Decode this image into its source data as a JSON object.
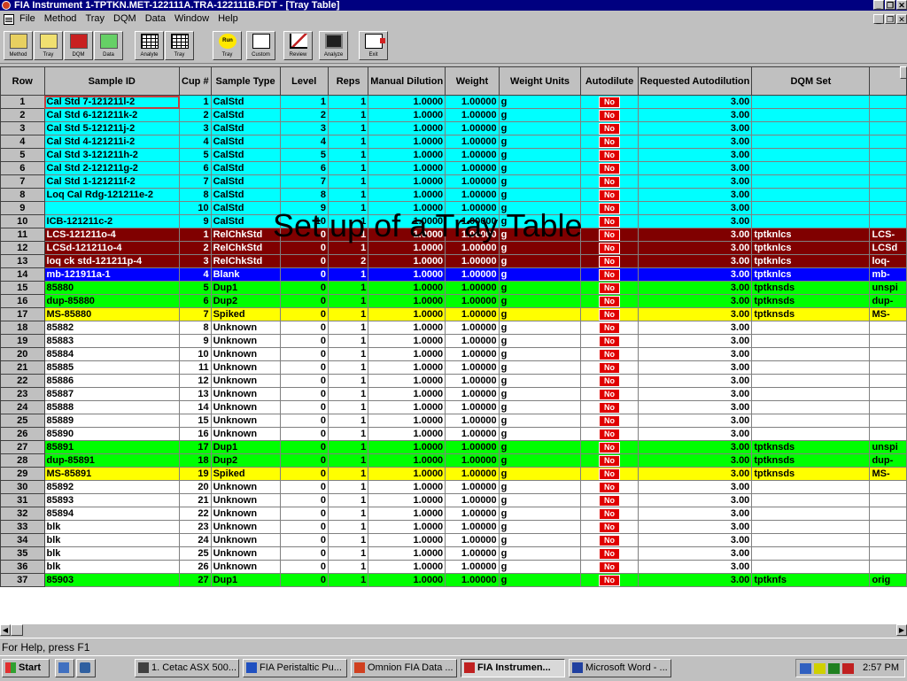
{
  "window": {
    "title": "FIA Instrument 1-TPTKN.MET-122111A.TRA-122111B.FDT - [Tray Table]"
  },
  "menu": [
    "File",
    "Method",
    "Tray",
    "DQM",
    "Data",
    "Window",
    "Help"
  ],
  "toolbar": [
    {
      "label": "Method",
      "icon": "folder-open-icon"
    },
    {
      "label": "Tray",
      "icon": "folder-open-icon"
    },
    {
      "label": "DQM",
      "icon": "folder-red-icon"
    },
    {
      "label": "Data",
      "icon": "folder-green-icon"
    },
    {
      "label": "Analyte",
      "icon": "grid-icon"
    },
    {
      "label": "Tray",
      "icon": "grid-icon"
    },
    {
      "label": "Tray",
      "icon": "run-icon"
    },
    {
      "label": "Custom",
      "icon": "chart-icon"
    },
    {
      "label": "Review",
      "icon": "review-icon"
    },
    {
      "label": "Analyze",
      "icon": "analyze-icon"
    },
    {
      "label": "Exit",
      "icon": "exit-icon"
    }
  ],
  "run_icon_text": "Run",
  "columns": [
    "Row",
    "Sample ID",
    "Cup #",
    "Sample Type",
    "Level",
    "Reps",
    "Manual Dilution",
    "Weight",
    "Weight Units",
    "Autodilute",
    "Requested Autodilution",
    "DQM Set",
    ""
  ],
  "colors": {
    "cyan": "#00ffff",
    "maroon": "#800000",
    "blue": "#0000ff",
    "green": "#00ff00",
    "yellow": "#ffff00",
    "white": "#ffffff"
  },
  "rows": [
    {
      "row": "1",
      "id": "Cal Std 7-121211l-2",
      "cup": "1",
      "type": "CalStd",
      "level": "1",
      "reps": "1",
      "dil": "1.0000",
      "weight": "1.00000",
      "units": "g",
      "auto": "No",
      "req": "3.00",
      "dqm": "",
      "extra": "",
      "color": "cyan"
    },
    {
      "row": "2",
      "id": "Cal Std 6-121211k-2",
      "cup": "2",
      "type": "CalStd",
      "level": "2",
      "reps": "1",
      "dil": "1.0000",
      "weight": "1.00000",
      "units": "g",
      "auto": "No",
      "req": "3.00",
      "dqm": "",
      "extra": "",
      "color": "cyan"
    },
    {
      "row": "3",
      "id": "Cal Std 5-121211j-2",
      "cup": "3",
      "type": "CalStd",
      "level": "3",
      "reps": "1",
      "dil": "1.0000",
      "weight": "1.00000",
      "units": "g",
      "auto": "No",
      "req": "3.00",
      "dqm": "",
      "extra": "",
      "color": "cyan"
    },
    {
      "row": "4",
      "id": "Cal Std 4-121211i-2",
      "cup": "4",
      "type": "CalStd",
      "level": "4",
      "reps": "1",
      "dil": "1.0000",
      "weight": "1.00000",
      "units": "g",
      "auto": "No",
      "req": "3.00",
      "dqm": "",
      "extra": "",
      "color": "cyan"
    },
    {
      "row": "5",
      "id": "Cal Std 3-121211h-2",
      "cup": "5",
      "type": "CalStd",
      "level": "5",
      "reps": "1",
      "dil": "1.0000",
      "weight": "1.00000",
      "units": "g",
      "auto": "No",
      "req": "3.00",
      "dqm": "",
      "extra": "",
      "color": "cyan"
    },
    {
      "row": "6",
      "id": "Cal Std 2-121211g-2",
      "cup": "6",
      "type": "CalStd",
      "level": "6",
      "reps": "1",
      "dil": "1.0000",
      "weight": "1.00000",
      "units": "g",
      "auto": "No",
      "req": "3.00",
      "dqm": "",
      "extra": "",
      "color": "cyan"
    },
    {
      "row": "7",
      "id": "Cal Std 1-121211f-2",
      "cup": "7",
      "type": "CalStd",
      "level": "7",
      "reps": "1",
      "dil": "1.0000",
      "weight": "1.00000",
      "units": "g",
      "auto": "No",
      "req": "3.00",
      "dqm": "",
      "extra": "",
      "color": "cyan"
    },
    {
      "row": "8",
      "id": "Loq Cal Rdg-121211e-2",
      "cup": "8",
      "type": "CalStd",
      "level": "8",
      "reps": "1",
      "dil": "1.0000",
      "weight": "1.00000",
      "units": "g",
      "auto": "No",
      "req": "3.00",
      "dqm": "",
      "extra": "",
      "color": "cyan"
    },
    {
      "row": "9",
      "id": "",
      "cup": "10",
      "type": "CalStd",
      "level": "9",
      "reps": "1",
      "dil": "1.0000",
      "weight": "1.00000",
      "units": "g",
      "auto": "No",
      "req": "3.00",
      "dqm": "",
      "extra": "",
      "color": "cyan"
    },
    {
      "row": "10",
      "id": "ICB-121211c-2",
      "cup": "9",
      "type": "CalStd",
      "level": "10",
      "reps": "1",
      "dil": "1.0000",
      "weight": "1.00000",
      "units": "g",
      "auto": "No",
      "req": "3.00",
      "dqm": "",
      "extra": "",
      "color": "cyan"
    },
    {
      "row": "11",
      "id": "LCS-121211o-4",
      "cup": "1",
      "type": "RelChkStd",
      "level": "0",
      "reps": "1",
      "dil": "1.0000",
      "weight": "1.00000",
      "units": "g",
      "auto": "No",
      "req": "3.00",
      "dqm": "tptknlcs",
      "extra": "LCS-",
      "color": "maroon"
    },
    {
      "row": "12",
      "id": "LCSd-121211o-4",
      "cup": "2",
      "type": "RelChkStd",
      "level": "0",
      "reps": "1",
      "dil": "1.0000",
      "weight": "1.00000",
      "units": "g",
      "auto": "No",
      "req": "3.00",
      "dqm": "tptknlcs",
      "extra": "LCSd",
      "color": "maroon"
    },
    {
      "row": "13",
      "id": "loq ck std-121211p-4",
      "cup": "3",
      "type": "RelChkStd",
      "level": "0",
      "reps": "2",
      "dil": "1.0000",
      "weight": "1.00000",
      "units": "g",
      "auto": "No",
      "req": "3.00",
      "dqm": "tptknlcs",
      "extra": "loq-",
      "color": "maroon"
    },
    {
      "row": "14",
      "id": "mb-121911a-1",
      "cup": "4",
      "type": "Blank",
      "level": "0",
      "reps": "1",
      "dil": "1.0000",
      "weight": "1.00000",
      "units": "g",
      "auto": "No",
      "req": "3.00",
      "dqm": "tptknlcs",
      "extra": "mb-",
      "color": "blue"
    },
    {
      "row": "15",
      "id": "85880",
      "cup": "5",
      "type": "Dup1",
      "level": "0",
      "reps": "1",
      "dil": "1.0000",
      "weight": "1.00000",
      "units": "g",
      "auto": "No",
      "req": "3.00",
      "dqm": "tptknsds",
      "extra": "unspi",
      "color": "green"
    },
    {
      "row": "16",
      "id": "dup-85880",
      "cup": "6",
      "type": "Dup2",
      "level": "0",
      "reps": "1",
      "dil": "1.0000",
      "weight": "1.00000",
      "units": "g",
      "auto": "No",
      "req": "3.00",
      "dqm": "tptknsds",
      "extra": "dup-",
      "color": "green"
    },
    {
      "row": "17",
      "id": "MS-85880",
      "cup": "7",
      "type": "Spiked",
      "level": "0",
      "reps": "1",
      "dil": "1.0000",
      "weight": "1.00000",
      "units": "g",
      "auto": "No",
      "req": "3.00",
      "dqm": "tptknsds",
      "extra": "MS-",
      "color": "yellow"
    },
    {
      "row": "18",
      "id": "85882",
      "cup": "8",
      "type": "Unknown",
      "level": "0",
      "reps": "1",
      "dil": "1.0000",
      "weight": "1.00000",
      "units": "g",
      "auto": "No",
      "req": "3.00",
      "dqm": "",
      "extra": "",
      "color": "white"
    },
    {
      "row": "19",
      "id": "85883",
      "cup": "9",
      "type": "Unknown",
      "level": "0",
      "reps": "1",
      "dil": "1.0000",
      "weight": "1.00000",
      "units": "g",
      "auto": "No",
      "req": "3.00",
      "dqm": "",
      "extra": "",
      "color": "white"
    },
    {
      "row": "20",
      "id": "85884",
      "cup": "10",
      "type": "Unknown",
      "level": "0",
      "reps": "1",
      "dil": "1.0000",
      "weight": "1.00000",
      "units": "g",
      "auto": "No",
      "req": "3.00",
      "dqm": "",
      "extra": "",
      "color": "white"
    },
    {
      "row": "21",
      "id": "85885",
      "cup": "11",
      "type": "Unknown",
      "level": "0",
      "reps": "1",
      "dil": "1.0000",
      "weight": "1.00000",
      "units": "g",
      "auto": "No",
      "req": "3.00",
      "dqm": "",
      "extra": "",
      "color": "white"
    },
    {
      "row": "22",
      "id": "85886",
      "cup": "12",
      "type": "Unknown",
      "level": "0",
      "reps": "1",
      "dil": "1.0000",
      "weight": "1.00000",
      "units": "g",
      "auto": "No",
      "req": "3.00",
      "dqm": "",
      "extra": "",
      "color": "white"
    },
    {
      "row": "23",
      "id": "85887",
      "cup": "13",
      "type": "Unknown",
      "level": "0",
      "reps": "1",
      "dil": "1.0000",
      "weight": "1.00000",
      "units": "g",
      "auto": "No",
      "req": "3.00",
      "dqm": "",
      "extra": "",
      "color": "white"
    },
    {
      "row": "24",
      "id": "85888",
      "cup": "14",
      "type": "Unknown",
      "level": "0",
      "reps": "1",
      "dil": "1.0000",
      "weight": "1.00000",
      "units": "g",
      "auto": "No",
      "req": "3.00",
      "dqm": "",
      "extra": "",
      "color": "white"
    },
    {
      "row": "25",
      "id": "85889",
      "cup": "15",
      "type": "Unknown",
      "level": "0",
      "reps": "1",
      "dil": "1.0000",
      "weight": "1.00000",
      "units": "g",
      "auto": "No",
      "req": "3.00",
      "dqm": "",
      "extra": "",
      "color": "white"
    },
    {
      "row": "26",
      "id": "85890",
      "cup": "16",
      "type": "Unknown",
      "level": "0",
      "reps": "1",
      "dil": "1.0000",
      "weight": "1.00000",
      "units": "g",
      "auto": "No",
      "req": "3.00",
      "dqm": "",
      "extra": "",
      "color": "white"
    },
    {
      "row": "27",
      "id": "85891",
      "cup": "17",
      "type": "Dup1",
      "level": "0",
      "reps": "1",
      "dil": "1.0000",
      "weight": "1.00000",
      "units": "g",
      "auto": "No",
      "req": "3.00",
      "dqm": "tptknsds",
      "extra": "unspi",
      "color": "green"
    },
    {
      "row": "28",
      "id": "dup-85891",
      "cup": "18",
      "type": "Dup2",
      "level": "0",
      "reps": "1",
      "dil": "1.0000",
      "weight": "1.00000",
      "units": "g",
      "auto": "No",
      "req": "3.00",
      "dqm": "tptknsds",
      "extra": "dup-",
      "color": "green"
    },
    {
      "row": "29",
      "id": "MS-85891",
      "cup": "19",
      "type": "Spiked",
      "level": "0",
      "reps": "1",
      "dil": "1.0000",
      "weight": "1.00000",
      "units": "g",
      "auto": "No",
      "req": "3.00",
      "dqm": "tptknsds",
      "extra": "MS-",
      "color": "yellow"
    },
    {
      "row": "30",
      "id": "85892",
      "cup": "20",
      "type": "Unknown",
      "level": "0",
      "reps": "1",
      "dil": "1.0000",
      "weight": "1.00000",
      "units": "g",
      "auto": "No",
      "req": "3.00",
      "dqm": "",
      "extra": "",
      "color": "white"
    },
    {
      "row": "31",
      "id": "85893",
      "cup": "21",
      "type": "Unknown",
      "level": "0",
      "reps": "1",
      "dil": "1.0000",
      "weight": "1.00000",
      "units": "g",
      "auto": "No",
      "req": "3.00",
      "dqm": "",
      "extra": "",
      "color": "white"
    },
    {
      "row": "32",
      "id": "85894",
      "cup": "22",
      "type": "Unknown",
      "level": "0",
      "reps": "1",
      "dil": "1.0000",
      "weight": "1.00000",
      "units": "g",
      "auto": "No",
      "req": "3.00",
      "dqm": "",
      "extra": "",
      "color": "white"
    },
    {
      "row": "33",
      "id": "blk",
      "cup": "23",
      "type": "Unknown",
      "level": "0",
      "reps": "1",
      "dil": "1.0000",
      "weight": "1.00000",
      "units": "g",
      "auto": "No",
      "req": "3.00",
      "dqm": "",
      "extra": "",
      "color": "white"
    },
    {
      "row": "34",
      "id": "blk",
      "cup": "24",
      "type": "Unknown",
      "level": "0",
      "reps": "1",
      "dil": "1.0000",
      "weight": "1.00000",
      "units": "g",
      "auto": "No",
      "req": "3.00",
      "dqm": "",
      "extra": "",
      "color": "white"
    },
    {
      "row": "35",
      "id": "blk",
      "cup": "25",
      "type": "Unknown",
      "level": "0",
      "reps": "1",
      "dil": "1.0000",
      "weight": "1.00000",
      "units": "g",
      "auto": "No",
      "req": "3.00",
      "dqm": "",
      "extra": "",
      "color": "white"
    },
    {
      "row": "36",
      "id": "blk",
      "cup": "26",
      "type": "Unknown",
      "level": "0",
      "reps": "1",
      "dil": "1.0000",
      "weight": "1.00000",
      "units": "g",
      "auto": "No",
      "req": "3.00",
      "dqm": "",
      "extra": "",
      "color": "white"
    },
    {
      "row": "37",
      "id": "85903",
      "cup": "27",
      "type": "Dup1",
      "level": "0",
      "reps": "1",
      "dil": "1.0000",
      "weight": "1.00000",
      "units": "g",
      "auto": "No",
      "req": "3.00",
      "dqm": "tptknfs",
      "extra": "orig",
      "color": "green"
    }
  ],
  "overlay_title": "Set up of a Tray Table",
  "status": {
    "text": "For Help, press F1"
  },
  "taskbar": {
    "start": "Start",
    "items": [
      {
        "label": "1. Cetac ASX 500...",
        "active": false
      },
      {
        "label": "FIA Peristaltic Pu...",
        "active": false
      },
      {
        "label": "Omnion FIA Data ...",
        "active": false
      },
      {
        "label": "FIA Instrumen...",
        "active": true
      },
      {
        "label": "Microsoft Word - ...",
        "active": false
      }
    ],
    "clock": "2:57 PM"
  }
}
